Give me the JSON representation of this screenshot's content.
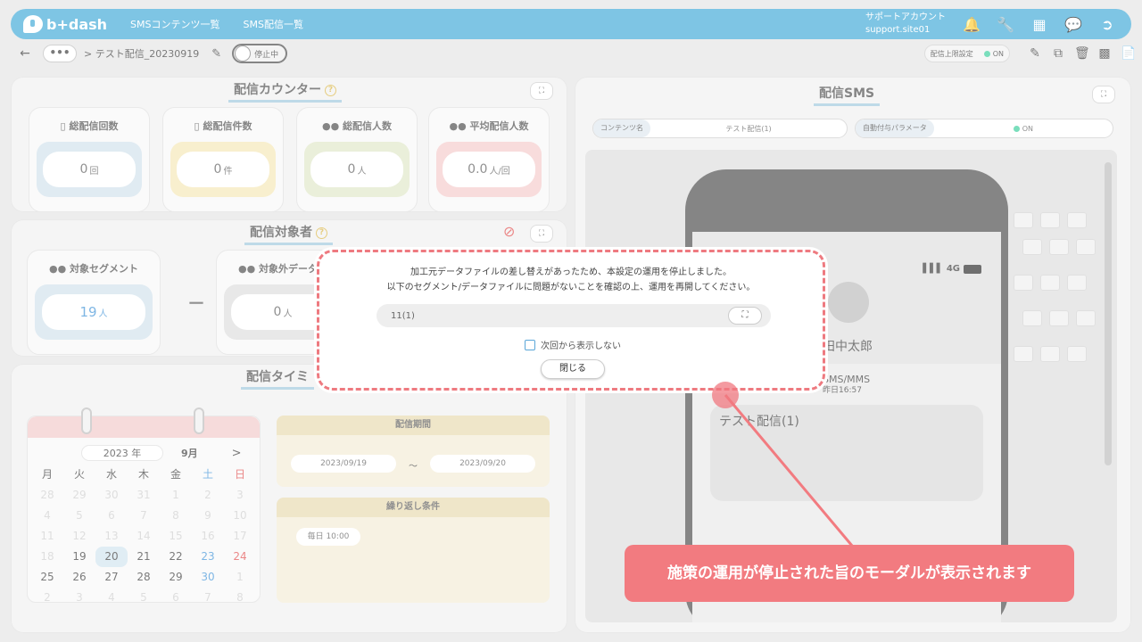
{
  "header": {
    "logo_text": "b+dash",
    "nav": [
      "SMSコンテンツ一覧",
      "SMS配信一覧"
    ],
    "account_name": "サポートアカウント",
    "account_id": "support.site01"
  },
  "subbar": {
    "dots": "•••",
    "breadcrumb": "> テスト配信_20230919",
    "toggle_label": "停止中",
    "limit_label": "配信上限設定",
    "limit_state": "ON"
  },
  "counter_panel": {
    "title": "配信カウンター",
    "cards": [
      {
        "title": "総配信回数",
        "value": "0",
        "unit": "回",
        "color": "#cfe0ec"
      },
      {
        "title": "総配信件数",
        "value": "0",
        "unit": "件",
        "color": "#f4e7b4"
      },
      {
        "title": "総配信人数",
        "value": "0",
        "unit": "人",
        "color": "#dfe6c6"
      },
      {
        "title": "平均配信人数",
        "value": "0.0",
        "unit": "人/回",
        "color": "#f4c9ca"
      }
    ]
  },
  "target_panel": {
    "title": "配信対象者",
    "segment_title": "対象セグメント",
    "segment_value": "19",
    "segment_unit": "人",
    "minus": "－",
    "excluded_title": "対象外データフ",
    "excluded_value": "0",
    "excluded_unit": "人"
  },
  "timing_panel": {
    "title": "配信タイミ",
    "calendar": {
      "year": "2023 年",
      "month": "9月",
      "next": ">",
      "weekdays": [
        "月",
        "火",
        "水",
        "木",
        "金",
        "土",
        "日"
      ],
      "rows": [
        [
          "28",
          "29",
          "30",
          "31",
          "1",
          "2",
          "3"
        ],
        [
          "4",
          "5",
          "6",
          "7",
          "8",
          "9",
          "10"
        ],
        [
          "11",
          "12",
          "13",
          "14",
          "15",
          "16",
          "17"
        ],
        [
          "18",
          "19",
          "20",
          "21",
          "22",
          "23",
          "24"
        ],
        [
          "25",
          "26",
          "27",
          "28",
          "29",
          "30",
          "1"
        ],
        [
          "2",
          "3",
          "4",
          "5",
          "6",
          "7",
          "8"
        ]
      ]
    },
    "period_title": "配信期間",
    "period_start": "2023/09/19",
    "period_sep": "～",
    "period_end": "2023/09/20",
    "repeat_title": "繰り返し条件",
    "repeat_value": "毎日 10:00"
  },
  "sms_panel": {
    "title": "配信SMS",
    "content_label": "コンテンツ名",
    "content_value": "テスト配信(1)",
    "param_label": "自動付与パラメータ",
    "param_value": "ON",
    "signal": "4G",
    "contact": "田中太郎",
    "msg_type": "SMS/MMS",
    "msg_time": "昨日16:57",
    "message": "テスト配信(1)"
  },
  "modal": {
    "line1": "加工元データファイルの差し替えがあったため、本設定の運用を停止しました。",
    "line2": "以下のセグメント/データファイルに問題がないことを確認の上、運用を再開してください。",
    "field_value": "11(1)",
    "checkbox_label": "次回から表示しない",
    "close_label": "閉じる"
  },
  "callout": {
    "text": "施策の運用が停止された旨のモーダルが表示されます"
  }
}
